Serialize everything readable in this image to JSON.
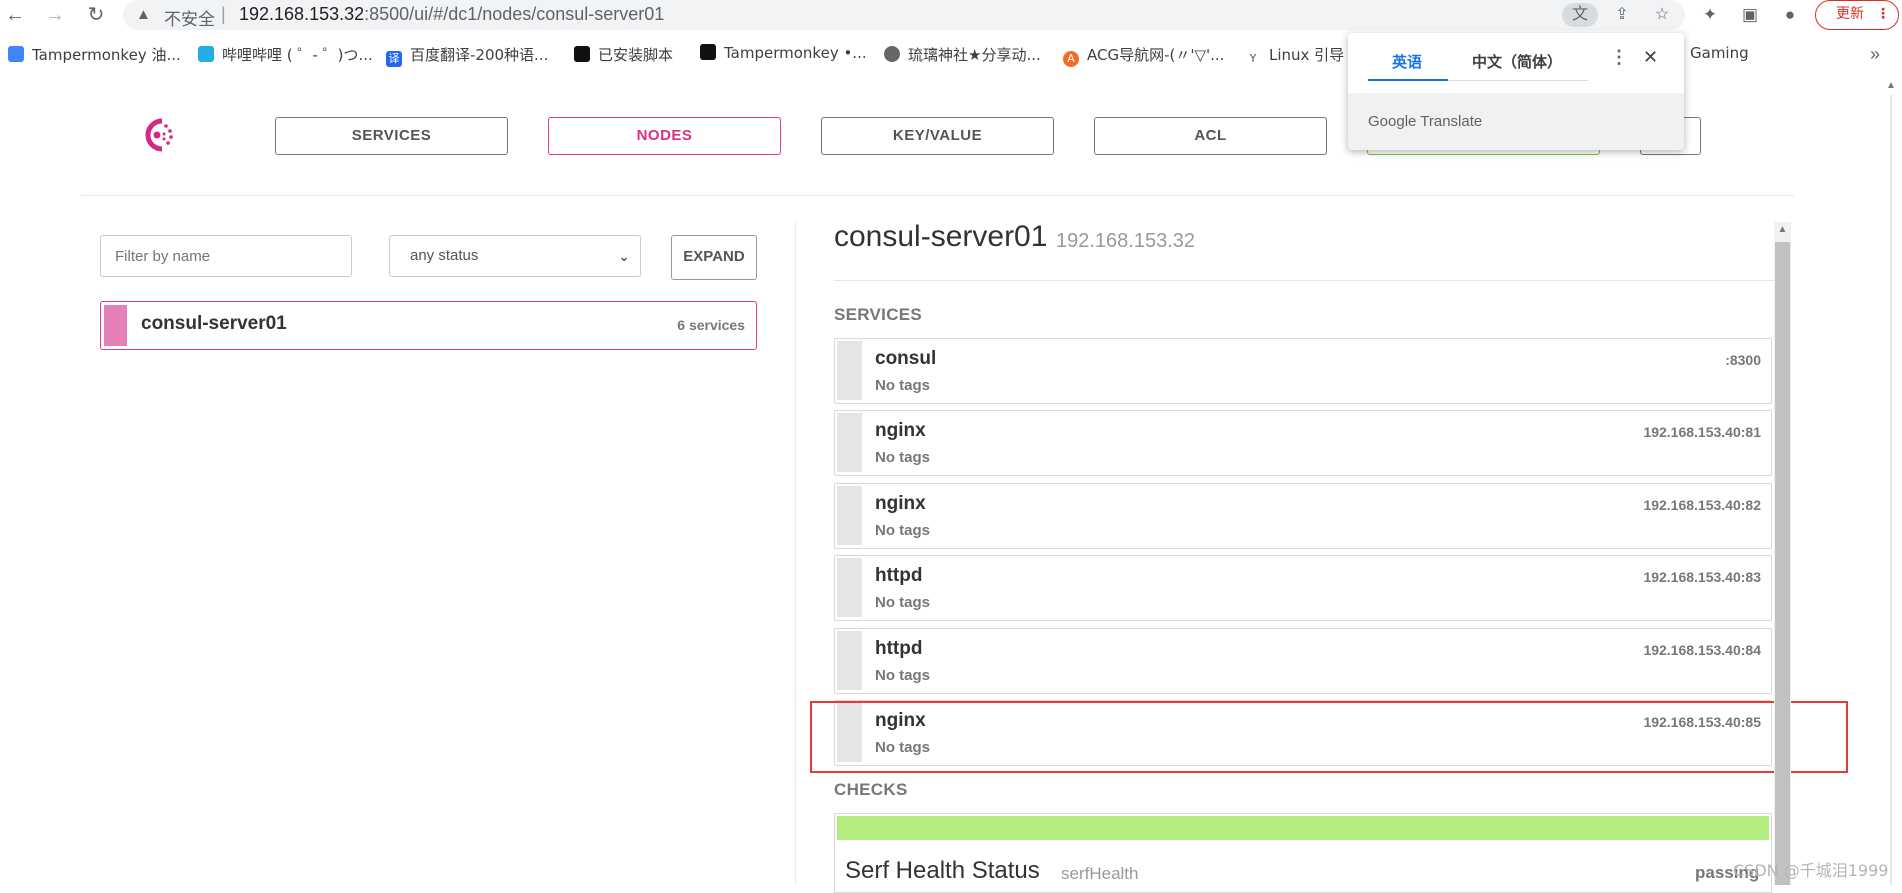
{
  "browser": {
    "url_insecure_label": "不安全",
    "url_separator": "|",
    "url_host": "192.168.153.32",
    "url_rest": ":8500/ui/#/dc1/nodes/consul-server01",
    "update_label": "更新",
    "bookmarks": [
      {
        "label": "Tampermonkey 油...",
        "icon": "tampermonkey-icon"
      },
      {
        "label": "哔哩哔哩 ( ゜- ゜)つ...",
        "icon": "bilibili-icon"
      },
      {
        "label": "百度翻译-200种语...",
        "icon": "baidu-translate-icon"
      },
      {
        "label": "已安装脚本",
        "icon": "tampermonkey-icon"
      },
      {
        "label": "Tampermonkey •...",
        "icon": "tampermonkey-icon"
      },
      {
        "label": "琉璃神社★分享动...",
        "icon": "globe-icon"
      },
      {
        "label": "ACG导航网-(〃'▽'...",
        "icon": "acg-icon"
      },
      {
        "label": "Linux 引导",
        "icon": "linux-icon"
      },
      {
        "label": "Gaming",
        "icon": "folder-icon"
      }
    ]
  },
  "translate_popup": {
    "tab_source": "英语",
    "tab_target": "中文（简体）",
    "brand": "Google Translate"
  },
  "consul": {
    "nav": {
      "services": "SERVICES",
      "nodes": "NODES",
      "key_value": "KEY/VALUE",
      "acl": "ACL"
    },
    "filters": {
      "name_placeholder": "Filter by name",
      "status_selected": "any status",
      "expand_label": "EXPAND"
    },
    "node_list": [
      {
        "name": "consul-server01",
        "count": "6 services"
      }
    ],
    "detail": {
      "node_name": "consul-server01",
      "node_ip": "192.168.153.32",
      "services_heading": "SERVICES",
      "services": [
        {
          "name": "consul",
          "tags": "No tags",
          "address": ":8300"
        },
        {
          "name": "nginx",
          "tags": "No tags",
          "address": "192.168.153.40:81"
        },
        {
          "name": "nginx",
          "tags": "No tags",
          "address": "192.168.153.40:82"
        },
        {
          "name": "httpd",
          "tags": "No tags",
          "address": "192.168.153.40:83"
        },
        {
          "name": "httpd",
          "tags": "No tags",
          "address": "192.168.153.40:84"
        },
        {
          "name": "nginx",
          "tags": "No tags",
          "address": "192.168.153.40:85"
        }
      ],
      "checks_heading": "CHECKS",
      "check": {
        "name": "Serf Health Status",
        "id": "serfHealth",
        "status": "passing",
        "status_color": "#b3ed7f"
      }
    }
  },
  "watermark": "CSDN @千城泪1999",
  "colors": {
    "accent": "#e0398d",
    "highlight": "#e53935"
  }
}
